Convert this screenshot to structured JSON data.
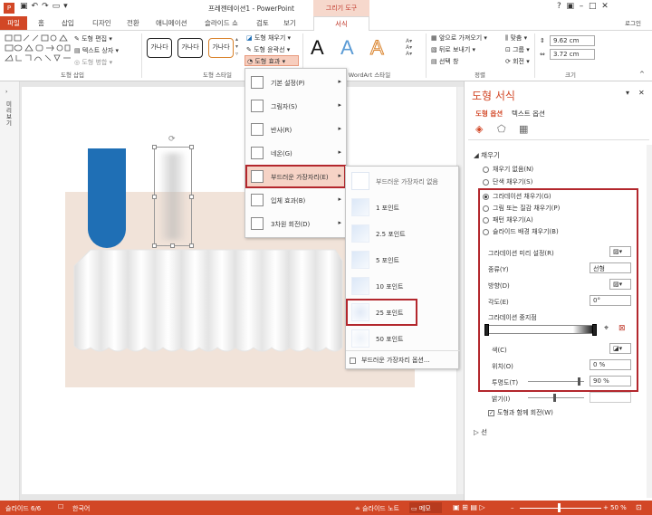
{
  "window": {
    "title": "프레젠테이션1 - PowerPoint",
    "context_tab": "그리기 도구",
    "user": "로그인"
  },
  "tabs": [
    "파일",
    "홈",
    "삽입",
    "디자인",
    "전환",
    "애니메이션",
    "슬라이드 쇼",
    "검토",
    "보기",
    "서식"
  ],
  "ribbon": {
    "insert_shapes": {
      "edit_shape": "도형 편집",
      "text_box": "텍스트 상자",
      "merge_shapes": "도형 병합",
      "label": "도형 삽입"
    },
    "shape_styles": {
      "samples": [
        "가나다",
        "가나다",
        "가나다"
      ],
      "fill": "도형 채우기",
      "outline": "도형 윤곽선",
      "effects": "도형 효과",
      "label": "도형 스타일"
    },
    "wordart": {
      "label": "WordArt 스타일",
      "letters": [
        "A",
        "A",
        "A"
      ]
    },
    "arrange": {
      "bring_forward": "앞으로 가져오기",
      "send_backward": "뒤로 보내기",
      "selection_pane": "선택 창",
      "align": "맞춤",
      "group": "그룹",
      "rotate": "회전",
      "label": "정렬"
    },
    "size": {
      "height": "9.62 cm",
      "width": "3.72 cm",
      "label": "크기"
    }
  },
  "effects_menu": [
    "기본 설정(P)",
    "그림자(S)",
    "반사(R)",
    "네온(G)",
    "부드러운 가장자리(E)",
    "입체 효과(B)",
    "3차원 회전(D)"
  ],
  "soft_edges_menu": [
    "부드러운 가장자리 없음",
    "1 포인트",
    "2.5 포인트",
    "5 포인트",
    "10 포인트",
    "25 포인트",
    "50 포인트"
  ],
  "soft_edges_options": "부드러운 가장자리 옵션...",
  "pane": {
    "title": "도형 서식",
    "tabs": [
      "도형 옵션",
      "텍스트 옵션"
    ],
    "section_fill": "채우기",
    "fill_options": [
      "채우기 없음(N)",
      "단색 채우기(S)",
      "그라데이션 채우기(G)",
      "그림 또는 질감 채우기(P)",
      "패턴 채우기(A)",
      "슬라이드 배경 채우기(B)"
    ],
    "gradient_preset": "그라데이션 미리 설정(R)",
    "type_label": "종류(Y)",
    "type_value": "선형",
    "direction_label": "방향(D)",
    "angle_label": "각도(E)",
    "angle_value": "0°",
    "stops_label": "그라데이션 중지점",
    "color_label": "색(C)",
    "position_label": "위치(O)",
    "position_value": "0 %",
    "transparency_label": "투명도(T)",
    "transparency_value": "90 %",
    "brightness_label": "밝기(I)",
    "rotate_with_shape": "도형과 함께 회전(W)",
    "section_line": "선"
  },
  "status": {
    "slide": "슬라이드 6/6",
    "language": "한국어",
    "notes": "슬라이드 노트",
    "memo": "메모",
    "zoom": "50 %"
  },
  "side_label": "미리 보기",
  "colors": {
    "accent": "#d24726",
    "highlight_border": "#b3272d",
    "shape_blue": "#1f6fb5",
    "slide_bg": "#f1e3d9"
  }
}
